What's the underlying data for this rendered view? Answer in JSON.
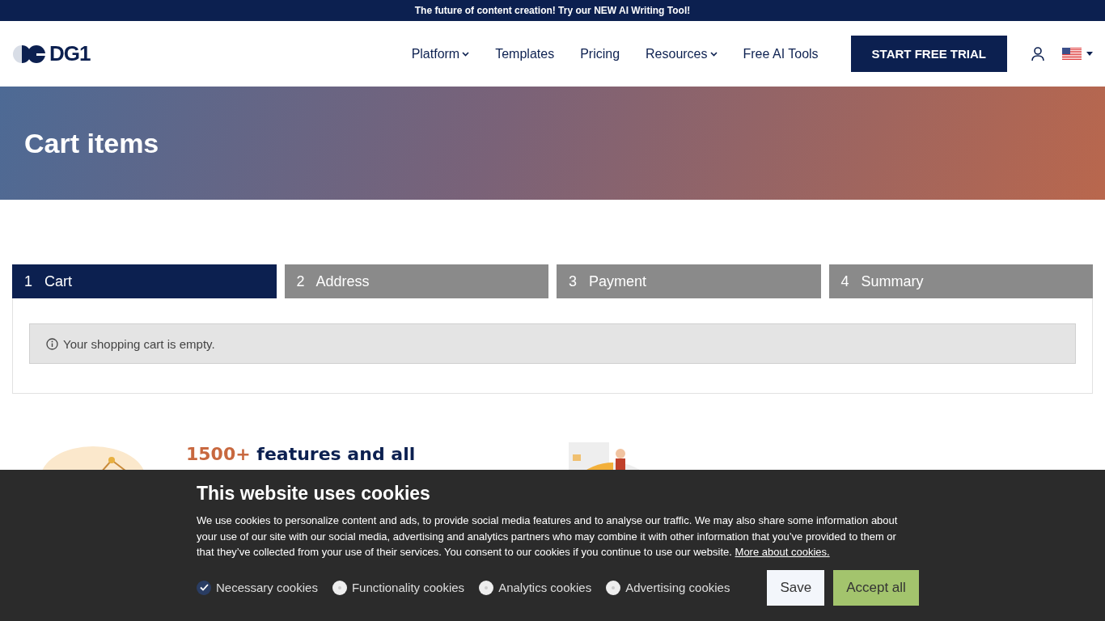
{
  "announcement": "The future of content creation! Try our NEW AI Writing Tool!",
  "header": {
    "logo": "DG1",
    "nav": [
      {
        "label": "Platform",
        "dropdown": true
      },
      {
        "label": "Templates",
        "dropdown": false
      },
      {
        "label": "Pricing",
        "dropdown": false
      },
      {
        "label": "Resources",
        "dropdown": true
      },
      {
        "label": "Free AI Tools",
        "dropdown": false
      }
    ],
    "cta": "START FREE TRIAL"
  },
  "hero": {
    "title": "Cart items"
  },
  "steps": [
    {
      "number": "1",
      "label": "Cart",
      "selected": true
    },
    {
      "number": "2",
      "label": "Address",
      "selected": false
    },
    {
      "number": "3",
      "label": "Payment",
      "selected": false
    },
    {
      "number": "4",
      "label": "Summary",
      "selected": false
    }
  ],
  "cart_notice": "Your shopping cart is empty.",
  "features": [
    {
      "kind": "chart",
      "headline": [
        {
          "text": "1500+",
          "accent": true
        },
        {
          "text": " features and all",
          "accent": false
        }
      ]
    },
    {
      "kind": "gauge"
    }
  ],
  "cookies": {
    "title": "This website uses cookies",
    "text": "We use cookies to personalize content and ads, to provide social media features and to analyse our traffic. We may also share some information about your use of our site with our social media, advertising and analytics partners who may combine it with other information that you’ve provided to them or that they’ve collected from your use of their services. You consent to our cookies if you continue to use our website.",
    "link": "More about cookies.",
    "options": [
      {
        "label": "Necessary cookies",
        "checked": true
      },
      {
        "label": "Functionality cookies",
        "checked": false
      },
      {
        "label": "Analytics cookies",
        "checked": false
      },
      {
        "label": "Advertising cookies",
        "checked": false
      }
    ],
    "buttons": [
      {
        "label": "Save",
        "kind": "secondary"
      },
      {
        "label": "Accept all",
        "kind": "primary"
      }
    ]
  }
}
